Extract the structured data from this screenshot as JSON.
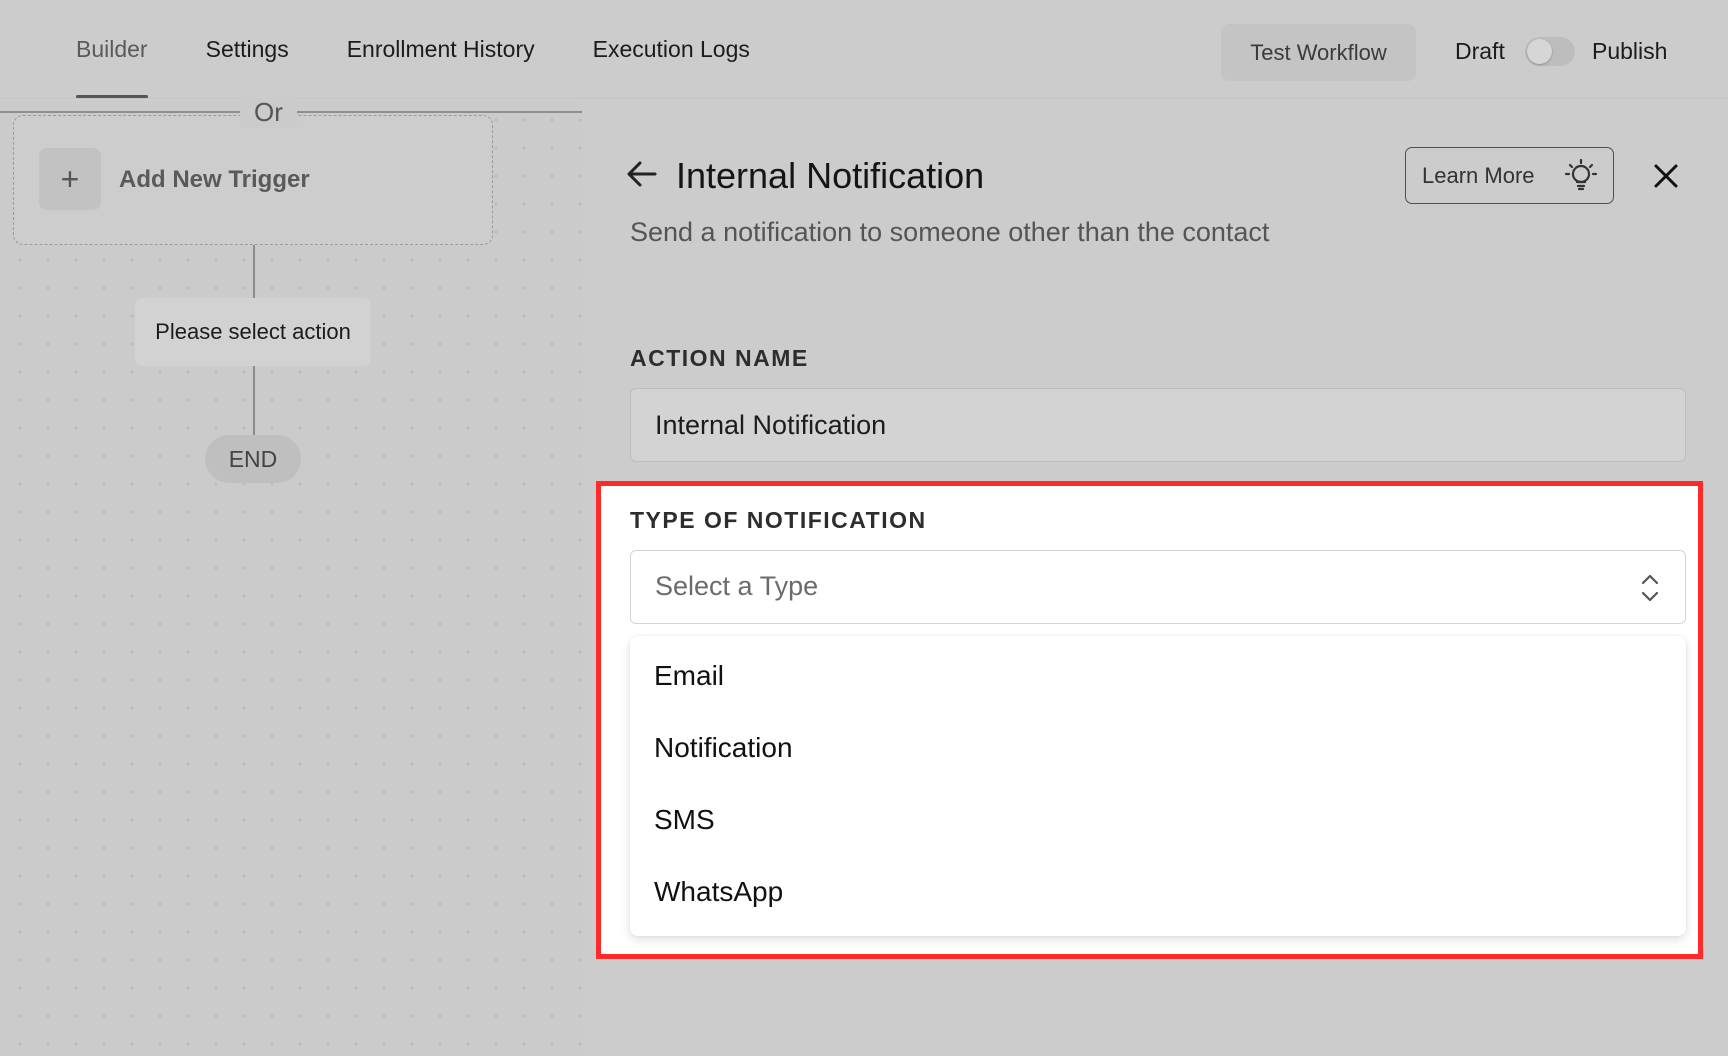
{
  "tabs": [
    {
      "label": "Builder",
      "active": true
    },
    {
      "label": "Settings"
    },
    {
      "label": "Enrollment History"
    },
    {
      "label": "Execution Logs"
    }
  ],
  "toolbar": {
    "test_label": "Test Workflow",
    "draft_label": "Draft",
    "publish_label": "Publish",
    "publish_toggle_on": false
  },
  "canvas": {
    "or_label": "Or",
    "add_trigger_label": "Add New Trigger",
    "plus_symbol": "+",
    "action_placeholder": "Please select action",
    "end_label": "END"
  },
  "panel": {
    "title": "Internal Notification",
    "subtitle": "Send a notification to someone other than the contact",
    "learn_more_label": "Learn More",
    "action_name_label": "ACTION NAME",
    "action_name_value": "Internal Notification",
    "type_label": "TYPE OF NOTIFICATION",
    "type_placeholder": "Select a Type",
    "type_options": [
      "Email",
      "Notification",
      "SMS",
      "WhatsApp"
    ]
  },
  "colors": {
    "highlight": "#ff2a2a",
    "overlay_gray": "#cccccc"
  }
}
